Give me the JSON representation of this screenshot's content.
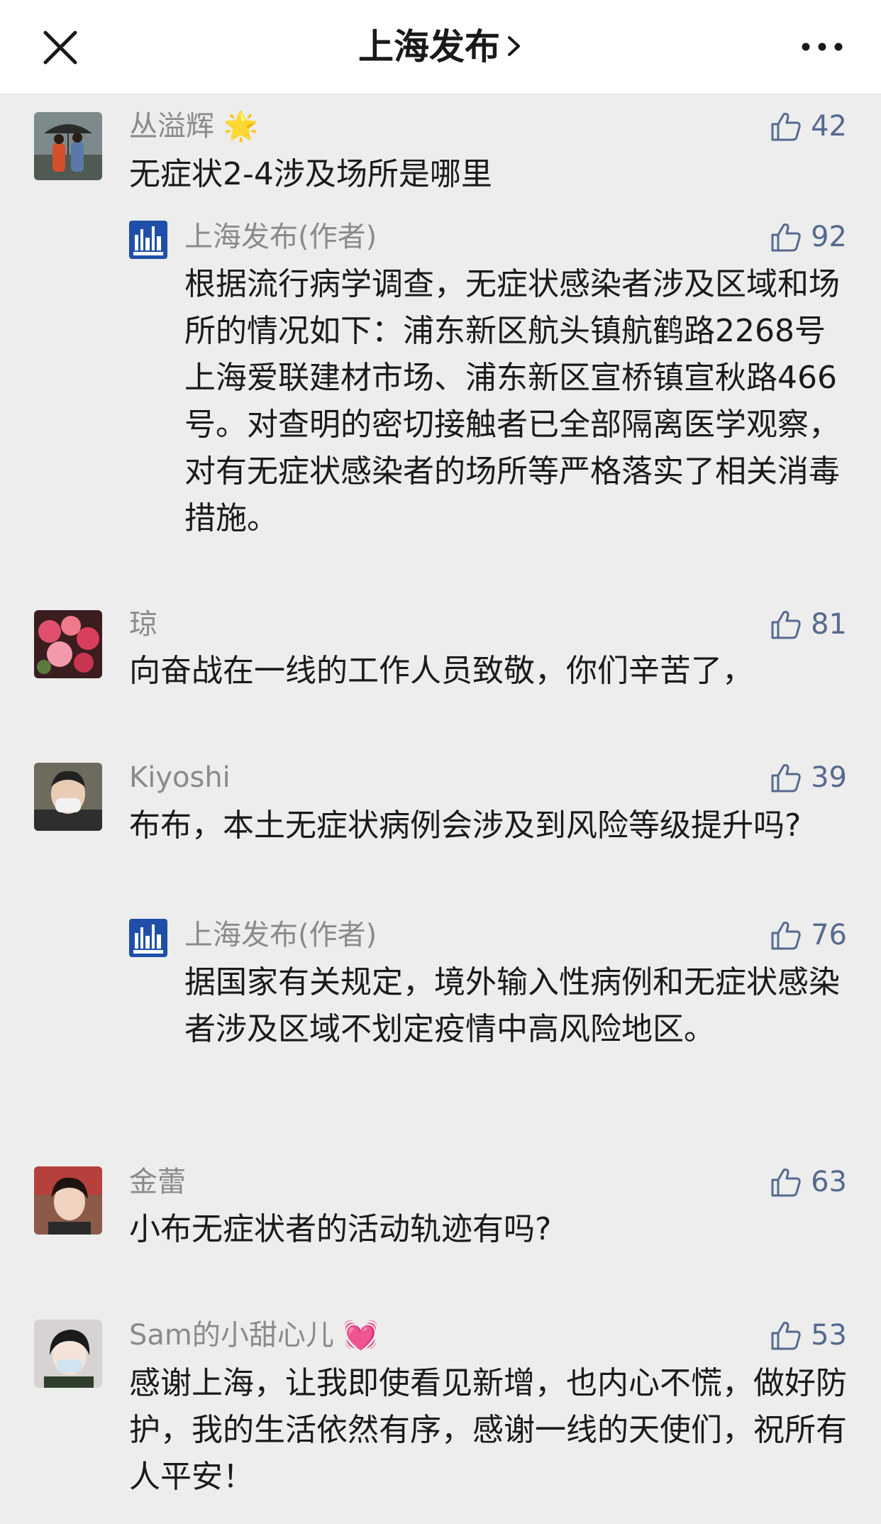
{
  "header": {
    "title": "上海发布"
  },
  "comments": [
    {
      "name": "丛溢辉",
      "badge": "🌟",
      "likes": "42",
      "text": "无症状2-4涉及场所是哪里",
      "reply": {
        "name": "上海发布(作者)",
        "likes": "92",
        "text": "根据流行病学调查，无症状感染者涉及区域和场所的情况如下：浦东新区航头镇航鹤路2268号上海爱联建材市场、浦东新区宣桥镇宣秋路466号。对查明的密切接触者已全部隔离医学观察，对有无症状感染者的场所等严格落实了相关消毒措施。"
      }
    },
    {
      "name": "琼",
      "likes": "81",
      "text": "向奋战在一线的工作人员致敬，你们辛苦了，"
    },
    {
      "name": "Kiyoshi",
      "likes": "39",
      "text": "布布，本土无症状病例会涉及到风险等级提升吗?",
      "reply": {
        "name": "上海发布(作者)",
        "likes": "76",
        "text": "据国家有关规定，境外输入性病例和无症状感染者涉及区域不划定疫情中高风险地区。"
      }
    },
    {
      "name": "金蕾",
      "likes": "63",
      "text": "小布无症状者的活动轨迹有吗?"
    },
    {
      "name": "Sam的小甜心儿",
      "badge": "💓",
      "likes": "53",
      "text": "感谢上海，让我即使看见新增，也内心不慌，做好防护，我的生活依然有序，感谢一线的天使们，祝所有人平安！"
    }
  ],
  "colors": {
    "background": "#ededed",
    "like_blue": "#56698f",
    "name_gray": "#8a8a8a",
    "text_dark": "#1a1a1a"
  },
  "icons": {
    "close": "close-icon",
    "more": "more-icon",
    "like": "thumbs-up-icon",
    "chevron": "chevron-right-icon"
  }
}
